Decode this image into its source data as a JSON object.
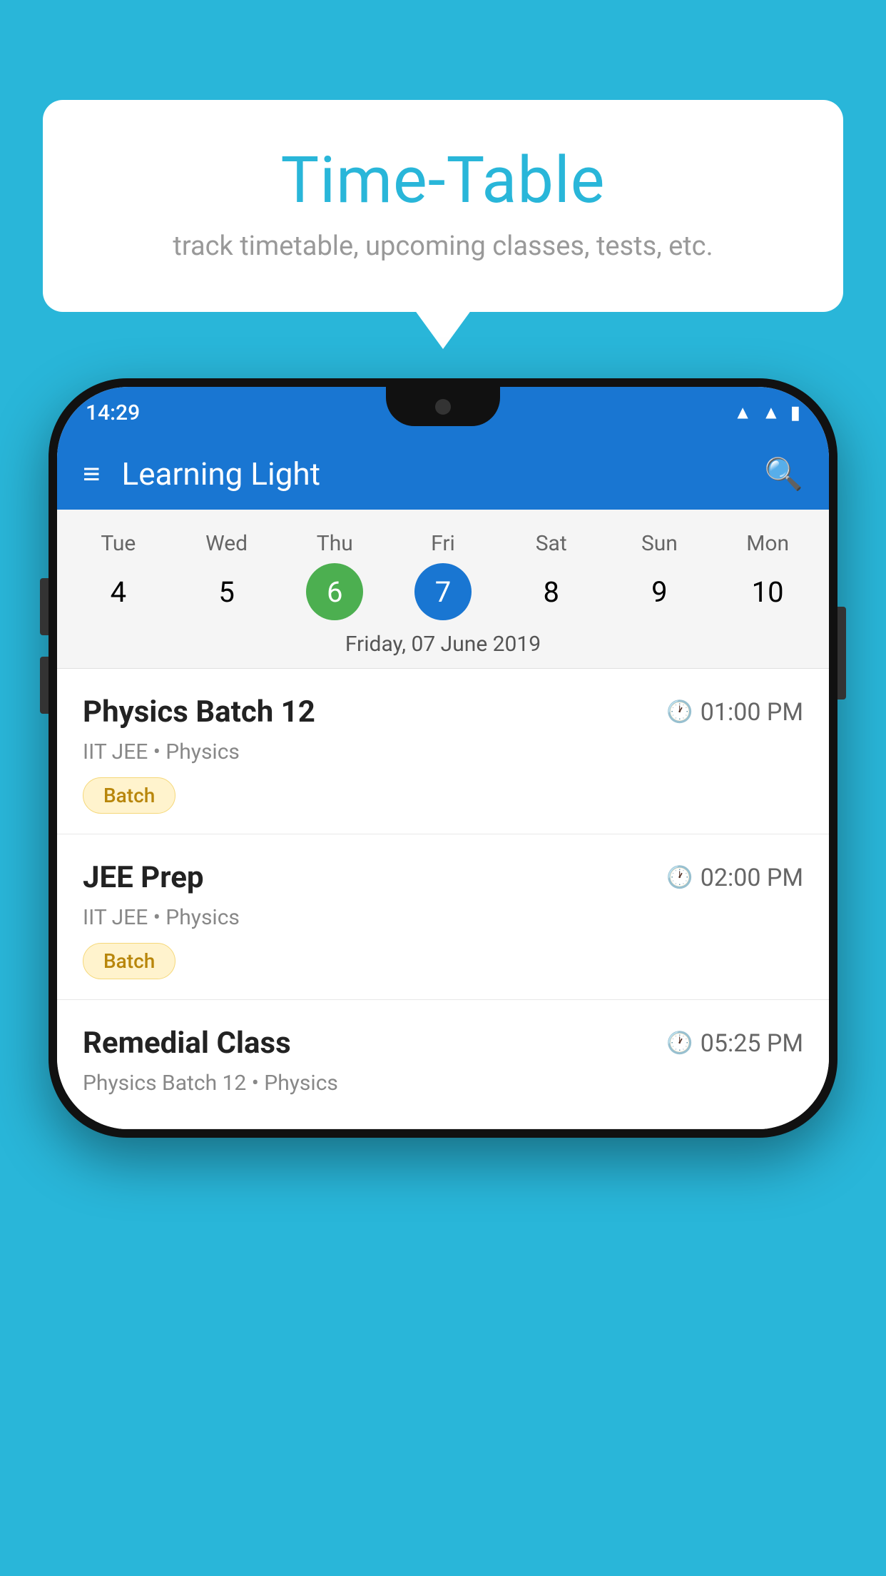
{
  "background_color": "#29b6d9",
  "bubble": {
    "title": "Time-Table",
    "subtitle": "track timetable, upcoming classes, tests, etc."
  },
  "phone": {
    "status_bar": {
      "time": "14:29"
    },
    "app_header": {
      "title": "Learning Light"
    },
    "calendar": {
      "days": [
        "Tue",
        "Wed",
        "Thu",
        "Fri",
        "Sat",
        "Sun",
        "Mon"
      ],
      "dates": [
        "4",
        "5",
        "6",
        "7",
        "8",
        "9",
        "10"
      ],
      "today_index": 2,
      "selected_index": 3,
      "selected_date_label": "Friday, 07 June 2019"
    },
    "schedule": [
      {
        "title": "Physics Batch 12",
        "time": "01:00 PM",
        "meta": "IIT JEE • Physics",
        "badge": "Batch"
      },
      {
        "title": "JEE Prep",
        "time": "02:00 PM",
        "meta": "IIT JEE • Physics",
        "badge": "Batch"
      },
      {
        "title": "Remedial Class",
        "time": "05:25 PM",
        "meta": "Physics Batch 12 • Physics",
        "badge": ""
      }
    ]
  }
}
